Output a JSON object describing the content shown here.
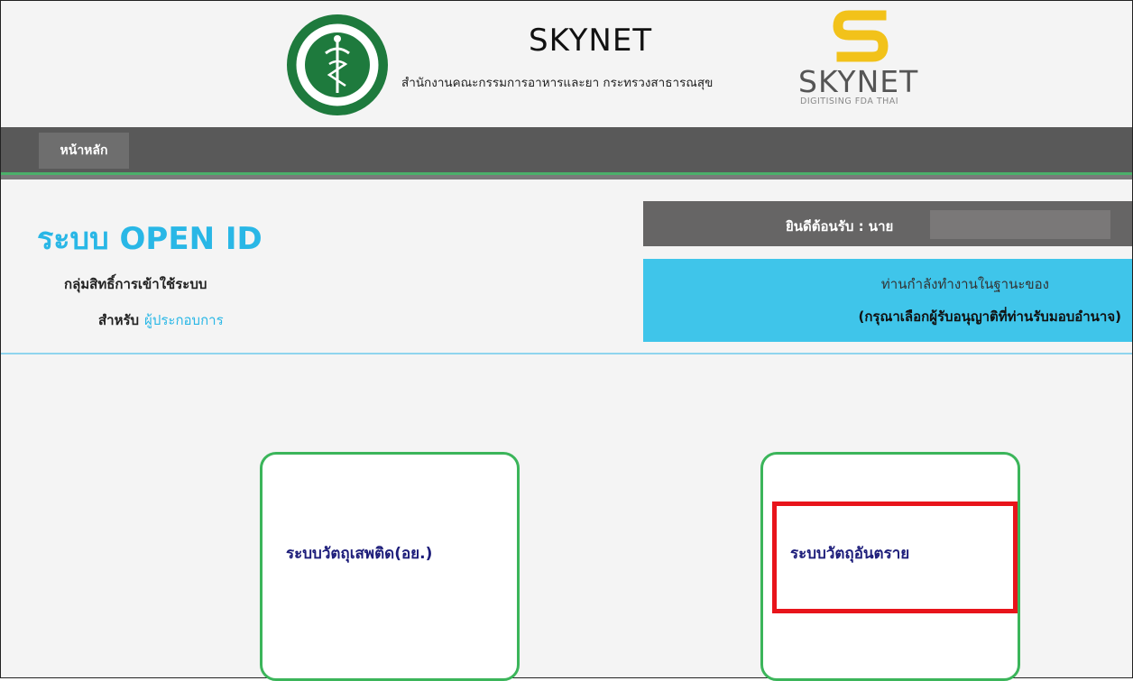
{
  "header": {
    "title": "SKYNET",
    "subtitle": "สำนักงานคณะกรรมการอาหารและยา กระทรวงสาธารณสุข",
    "logo_word": "SKYNET",
    "logo_tagline": "DIGITISING FDA THAI",
    "seal_icon": "ministry-of-public-health-seal",
    "logo_icon": "skynet-s-logo"
  },
  "nav": {
    "home_label": "หน้าหลัก"
  },
  "info": {
    "system_title": "ระบบ OPEN ID",
    "group_label": "กลุ่มสิทธิ์การเข้าใช้ระบบ",
    "for_prefix": "สำหรับ",
    "role": "ผู้ประกอบการ",
    "welcome": "ยินดีต้อนรับ : นาย",
    "status_line1": "ท่านกำลังทำงานในฐานะของ",
    "status_line2": "(กรุณาเลือกผู้รับอนุญาติที่ท่านรับมอบอำนาจ)"
  },
  "tiles": [
    {
      "label": "ระบบวัตถุเสพติด(อย.)"
    },
    {
      "label": "ระบบวัตถุอันตราย",
      "highlighted": true
    }
  ],
  "colors": {
    "accent_blue": "#29b7e6",
    "nav_gray": "#595959",
    "tile_border_green": "#3bb55a",
    "highlight_red": "#e8141b",
    "status_cyan": "#3fc5ea",
    "logo_gold": "#f2c21a"
  }
}
